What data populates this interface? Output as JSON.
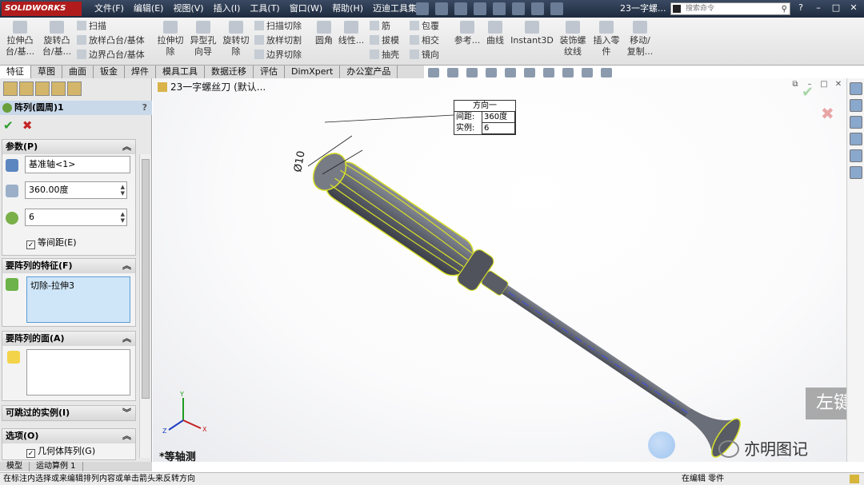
{
  "app": {
    "logo": "SOLIDWORKS",
    "doc_title": "23一字螺..."
  },
  "menus": [
    "文件(F)",
    "编辑(E)",
    "视图(V)",
    "插入(I)",
    "工具(T)",
    "窗口(W)",
    "帮助(H)",
    "迈迪工具集"
  ],
  "search": {
    "placeholder": "搜索命令"
  },
  "ribbon": {
    "big": [
      {
        "label": "拉伸凸\n台/基..."
      },
      {
        "label": "旋转凸\n台/基..."
      },
      {
        "label": "拉伸切\n除"
      },
      {
        "label": "异型孔\n向导"
      },
      {
        "label": "旋转切\n除"
      },
      {
        "label": "圆角"
      },
      {
        "label": "线性..."
      },
      {
        "label": "参考..."
      },
      {
        "label": "曲线"
      },
      {
        "label": "Instant3D"
      },
      {
        "label": "装饰螺\n纹线"
      },
      {
        "label": "插入零\n件"
      },
      {
        "label": "移动/\n复制..."
      }
    ],
    "small": [
      "扫描",
      "放样凸台/基体",
      "边界凸台/基体",
      "扫描切除",
      "放样切割",
      "边界切除",
      "筋",
      "拔模",
      "抽壳",
      "包覆",
      "相交",
      "镜向"
    ]
  },
  "tabs": [
    "特征",
    "草图",
    "曲面",
    "钣金",
    "焊件",
    "模具工具",
    "数据迁移",
    "评估",
    "DimXpert",
    "办公室产品"
  ],
  "panel": {
    "title": "阵列(圆周)1",
    "help": "?",
    "sections": {
      "params": {
        "label": "参数(P)",
        "axis": "基准轴<1>",
        "angle": "360.00度",
        "count": "6",
        "equal": "等间距(E)"
      },
      "features": {
        "label": "要阵列的特征(F)",
        "item": "切除-拉伸3"
      },
      "faces": {
        "label": "要阵列的面(A)"
      },
      "skip": {
        "label": "可跳过的实例(I)"
      },
      "options": {
        "label": "选项(O)",
        "geo": "几何体阵列(G)"
      }
    }
  },
  "bottom_tabs": [
    "模型",
    "运动算例 1"
  ],
  "viewport": {
    "tree": "23一字螺丝刀 (默认...",
    "callout": {
      "title": "方向一",
      "spacing_label": "间距:",
      "spacing": "360度",
      "count_label": "实例:",
      "count": "6"
    },
    "dimension": "Ø10",
    "view_name": "*等轴测",
    "overlay_key": "左键"
  },
  "watermark": "亦明图记",
  "status": {
    "hint": "在标注内选择或来编辑排列内容或单击箭头来反转方向",
    "mode": "在编辑 零件"
  }
}
